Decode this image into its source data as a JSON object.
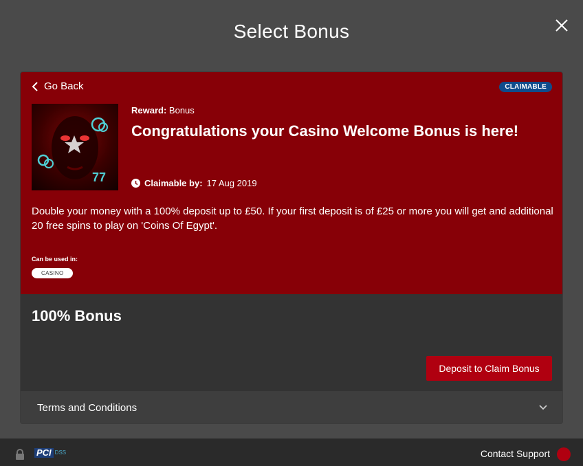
{
  "modal": {
    "title": "Select Bonus"
  },
  "card": {
    "go_back": "Go Back",
    "status_badge": "CLAIMABLE",
    "reward_label": "Reward:",
    "reward_value": "Bonus",
    "headline": "Congratulations your Casino Welcome Bonus is here!",
    "claimable_label": "Claimable by:",
    "claimable_date": "17 Aug 2019",
    "description": "Double your money with a 100% deposit up to £50. If your first deposit is of £25 or more you will get and additional 20 free spins to play on 'Coins Of Egypt'.",
    "used_in_label": "Can be used in:",
    "used_in_tags": [
      "CASINO"
    ],
    "bonus_name": "100% Bonus",
    "deposit_button": "Deposit to Claim Bonus",
    "terms_label": "Terms and Conditions"
  },
  "footer": {
    "pci_label": "PCI",
    "pci_dss": "DSS",
    "contact_support": "Contact Support"
  },
  "icons": {
    "close": "close-icon",
    "back": "chevron-left-icon",
    "clock": "clock-icon",
    "chevron": "chevron-down-icon",
    "lock": "lock-icon",
    "support": "support-icon"
  },
  "colors": {
    "background": "#4a4a4a",
    "card_top": "#870007",
    "card_bottom": "#333333",
    "badge": "#0f4c8c",
    "primary_button": "#b00010",
    "footer": "#2a2a2a"
  }
}
